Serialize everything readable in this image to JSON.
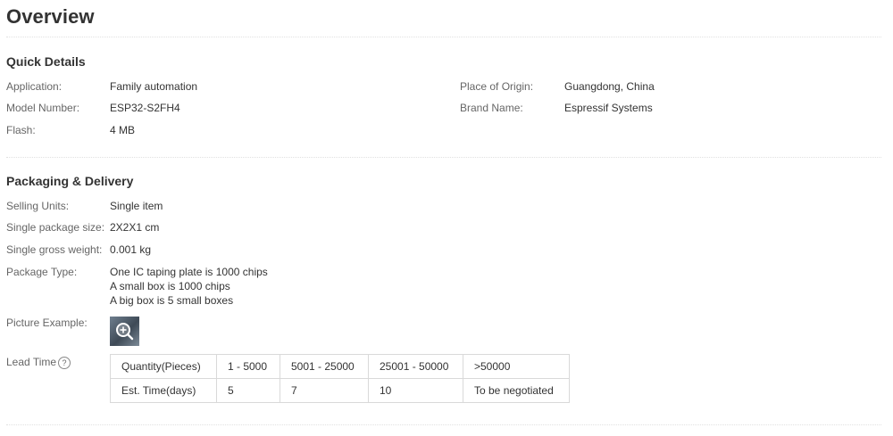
{
  "overview": {
    "title": "Overview"
  },
  "quick_details": {
    "title": "Quick Details",
    "left": [
      {
        "label": "Application:",
        "value": "Family automation"
      },
      {
        "label": "Model Number:",
        "value": "ESP32-S2FH4"
      },
      {
        "label": "Flash:",
        "value": "4 MB"
      }
    ],
    "right": [
      {
        "label": "Place of Origin:",
        "value": "Guangdong, China"
      },
      {
        "label": "Brand Name:",
        "value": "Espressif Systems"
      }
    ]
  },
  "packaging": {
    "title": "Packaging & Delivery",
    "selling_units": {
      "label": "Selling Units:",
      "value": "Single item"
    },
    "package_size": {
      "label": "Single package size:",
      "value": "2X2X1 cm"
    },
    "gross_weight": {
      "label": "Single gross weight:",
      "value": "0.001 kg"
    },
    "package_type": {
      "label": "Package Type:",
      "lines": [
        "One IC taping plate is 1000 chips",
        "A small box is 1000 chips",
        "A big box is 5 small boxes"
      ]
    },
    "picture_example": {
      "label": "Picture Example:",
      "icon": "zoom-in-icon"
    },
    "lead_time": {
      "label": "Lead Time",
      "help_glyph": "?",
      "header": [
        "Quantity(Pieces)",
        "1 - 5000",
        "5001 - 25000",
        "25001 - 50000",
        ">50000"
      ],
      "row": [
        "Est. Time(days)",
        "5",
        "7",
        "10",
        "To be negotiated"
      ]
    }
  }
}
